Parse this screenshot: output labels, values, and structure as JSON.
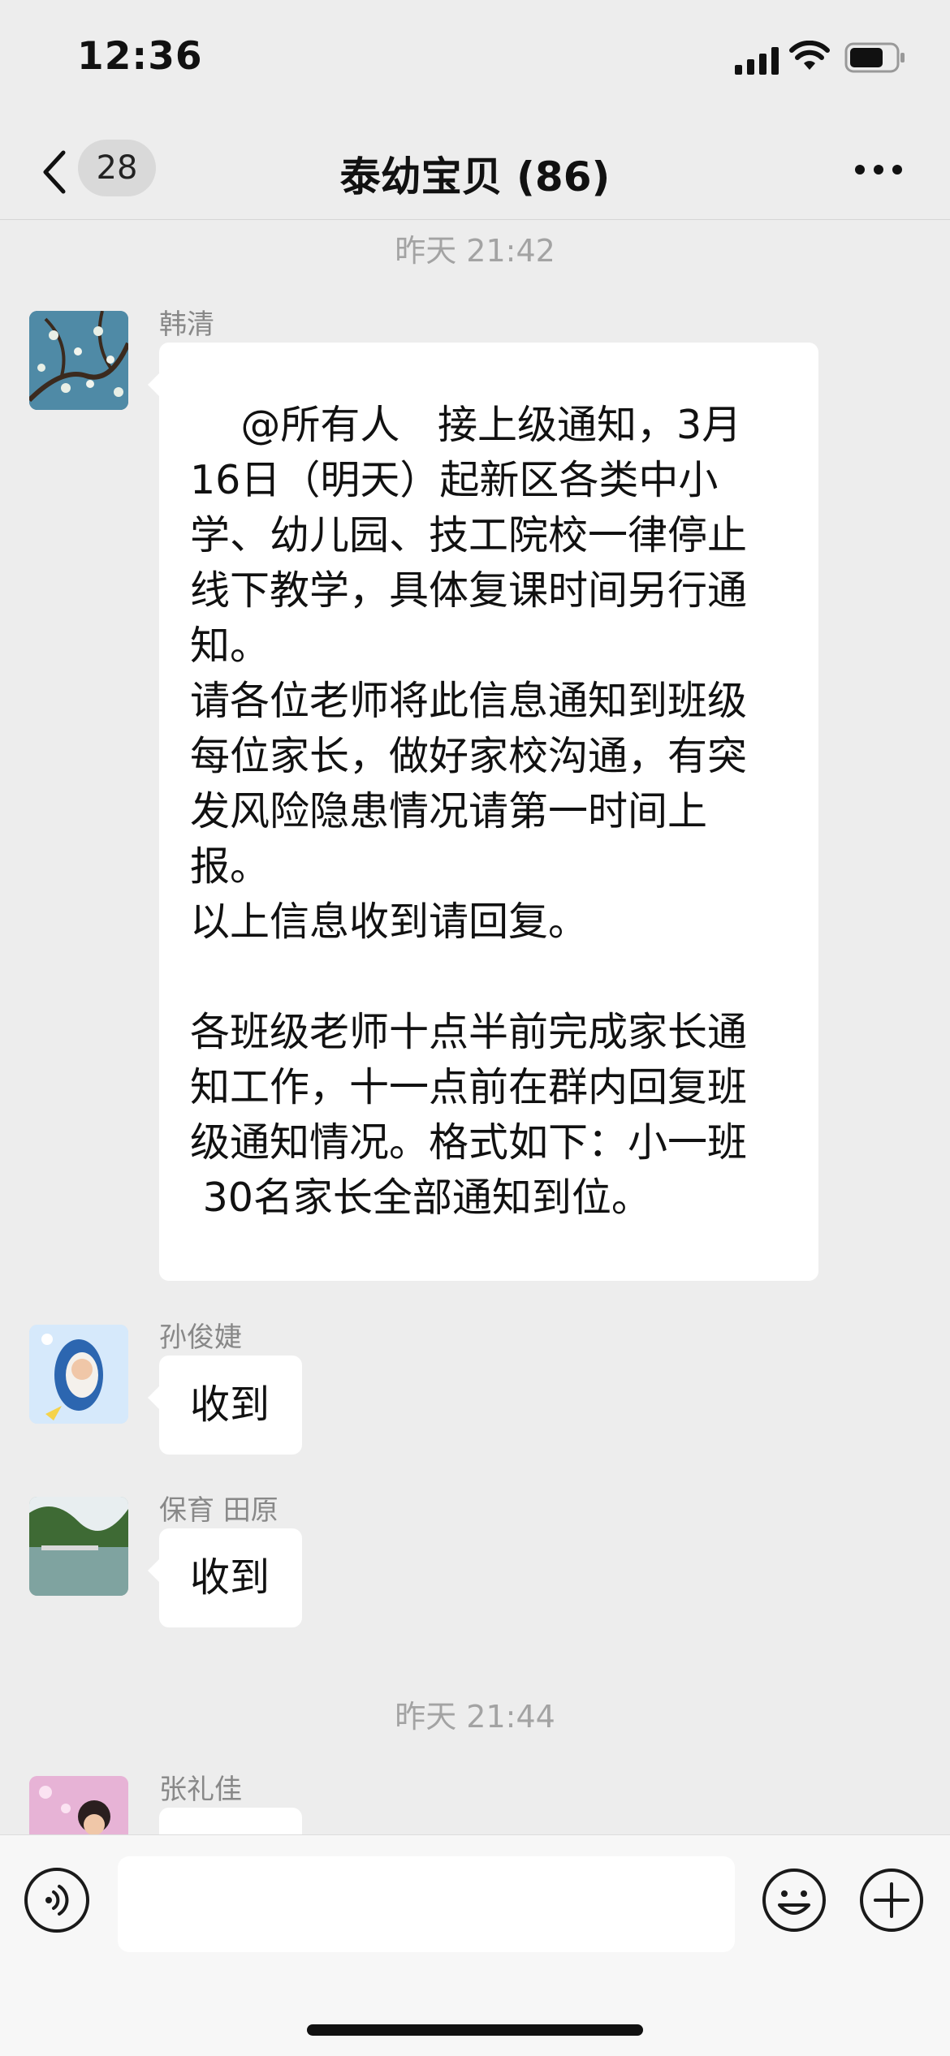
{
  "status_bar": {
    "time": "12:36"
  },
  "nav": {
    "unread_count": "28",
    "title": "泰幼宝贝 (86)"
  },
  "messages": [
    {
      "type": "timestamp",
      "text": "昨天 21:42"
    },
    {
      "type": "message",
      "sender": "韩清",
      "text": "\n    @所有人   接上级通知，3月\n16日（明天）起新区各类中小\n学、幼儿园、技工院校一律停止\n线下教学，具体复课时间另行通\n知。\n请各位老师将此信息通知到班级\n每位家长，做好家校沟通，有突\n发风险隐患情况请第一时间上\n报。\n以上信息收到请回复。\n\n各班级老师十点半前完成家长通\n知工作，十一点前在群内回复班\n级通知情况。格式如下：小一班\n 30名家长全部通知到位。"
    },
    {
      "type": "message",
      "sender": "孙俊婕",
      "text": "收到"
    },
    {
      "type": "message",
      "sender": "保育  田原",
      "text": "收到"
    },
    {
      "type": "timestamp",
      "text": "昨天 21:44"
    },
    {
      "type": "message",
      "sender": "张礼佳",
      "text": ""
    }
  ],
  "input_bar": {
    "placeholder": ""
  },
  "icons": {
    "back": "chevron-left-icon",
    "more": "more-dots-icon",
    "voice": "voice-icon",
    "emoji": "emoji-icon",
    "plus": "plus-icon"
  }
}
